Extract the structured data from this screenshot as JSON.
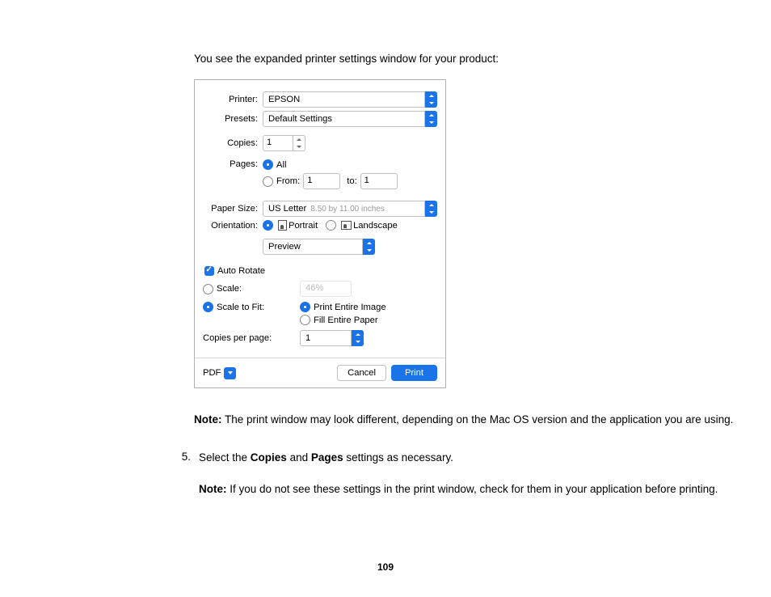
{
  "intro": "You see the expanded printer settings window for your product:",
  "dialog": {
    "printer_label": "Printer:",
    "printer_value": "EPSON",
    "presets_label": "Presets:",
    "presets_value": "Default Settings",
    "copies_label": "Copies:",
    "copies_value": "1",
    "pages_label": "Pages:",
    "pages_all": "All",
    "pages_from": "From:",
    "pages_from_val": "1",
    "pages_to": "to:",
    "pages_to_val": "1",
    "paper_size_label": "Paper Size:",
    "paper_size_value": "US Letter",
    "paper_size_hint": "8.50 by 11.00 inches",
    "orientation_label": "Orientation:",
    "orientation_portrait": "Portrait",
    "orientation_landscape": "Landscape",
    "pane": "Preview",
    "auto_rotate": "Auto Rotate",
    "scale": "Scale:",
    "scale_value": "46%",
    "scale_to_fit": "Scale to Fit:",
    "print_entire": "Print Entire Image",
    "fill_paper": "Fill Entire Paper",
    "copies_per_page": "Copies per page:",
    "copies_per_page_val": "1",
    "pdf": "PDF",
    "cancel": "Cancel",
    "print": "Print"
  },
  "note1_strong": "Note:",
  "note1": " The print window may look different, depending on the Mac OS version and the application you are using.",
  "step_num": "5.",
  "step_a": "Select the ",
  "step_b": "Copies",
  "step_c": " and ",
  "step_d": "Pages",
  "step_e": " settings as necessary.",
  "note2_strong": "Note:",
  "note2": " If you do not see these settings in the print window, check for them in your application before printing.",
  "page_number": "109"
}
